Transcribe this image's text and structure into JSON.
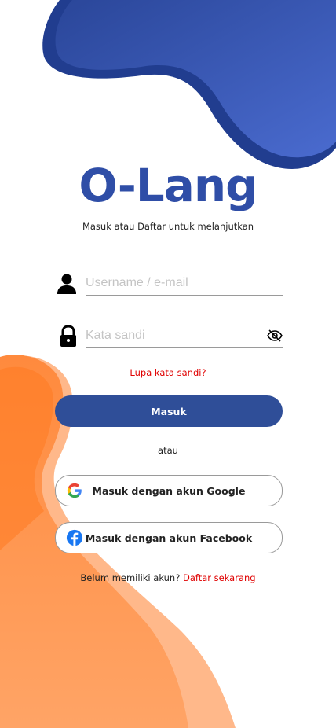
{
  "app": {
    "logo_text": "O-Lang",
    "subtitle": "Masuk atau Daftar untuk melanjutkan"
  },
  "form": {
    "username": {
      "placeholder": "Username / e-mail",
      "value": "",
      "icon": "person-icon"
    },
    "password": {
      "placeholder": "Kata sandi",
      "value": "",
      "icon": "lock-icon",
      "toggle_icon": "eye-slash-icon"
    },
    "forgot_label": "Lupa kata sandi?",
    "submit_label": "Masuk"
  },
  "divider_label": "atau",
  "social": [
    {
      "label": "Masuk dengan akun Google",
      "icon": "google-icon"
    },
    {
      "label": "Masuk dengan akun Facebook",
      "icon": "facebook-icon"
    }
  ],
  "register": {
    "prompt": "Belum memiliki akun?",
    "link_label": "Daftar sekarang"
  },
  "colors": {
    "brand_blue": "#2f4ea7",
    "button_blue": "#2f4e98",
    "link_red": "#e00000",
    "accent_orange": "#ff8a3d",
    "light_orange": "#ffb88a"
  }
}
